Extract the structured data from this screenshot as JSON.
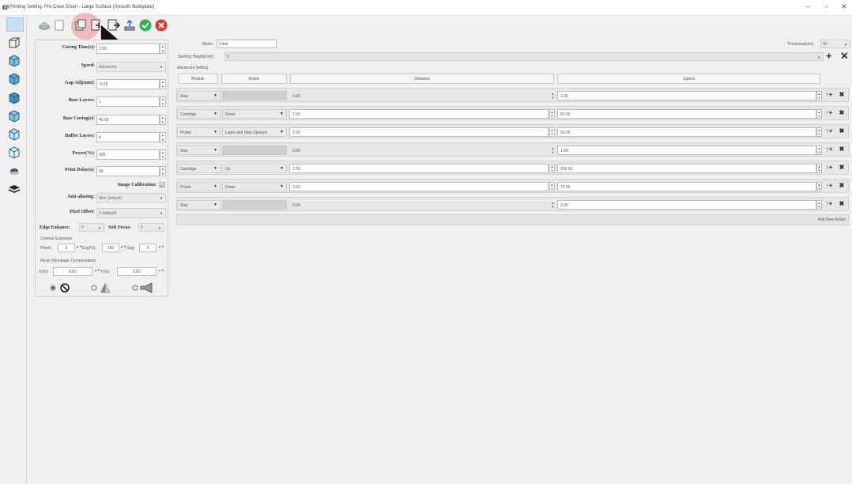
{
  "window": {
    "title": "Printing Setting: Pro Clear 50um - Large Surface (Smooth Buildplate)",
    "controls": [
      "–",
      "▫",
      "✕"
    ]
  },
  "toolbar": {
    "icons": [
      "cloud-icon",
      "new-file-icon",
      "copy-icon",
      "import-icon",
      "export-icon",
      "upload-icon",
      "check-icon",
      "cancel-icon"
    ]
  },
  "sidebar": {
    "icons": [
      "shape-icon",
      "cube-icon-1",
      "cube-icon-2",
      "cube-icon-3",
      "cube-icon-4",
      "cube-icon-5",
      "cube-icon-6",
      "layer-eye-icon",
      "layers-icon"
    ]
  },
  "left_panel": {
    "curing_time": {
      "label": "Curing Time(s):",
      "value": "1.50"
    },
    "speed": {
      "label": "Speed:",
      "value": "Advanced"
    },
    "gap_adj": {
      "label": "Gap Adj(mm):",
      "value": "-0.25"
    },
    "base_layers": {
      "label": "Base Layers:",
      "value": "1"
    },
    "base_curing": {
      "label": "Base Curing(s):",
      "value": "45.00"
    },
    "buffer_layers": {
      "label": "Buffer Layers:",
      "value": "4"
    },
    "power": {
      "label": "Power(%):",
      "value": "100"
    },
    "print_delay": {
      "label": "Print Delay(s):",
      "value": "90"
    },
    "image_calibration": {
      "label": "Image Calibration:",
      "checked": "☑"
    },
    "anti_aliasing": {
      "label": "Anti-aliasing:",
      "value": "Max (default)"
    },
    "pixel_offset": {
      "label": "Pixel Offset:",
      "value": "0 (default)"
    },
    "edge_enhance": {
      "label": "Edge Enhance:",
      "value": "0"
    },
    "soft_focus": {
      "label": "Soft Focus:",
      "value": "0"
    },
    "contour_exposure": {
      "title": "Contour Exposure",
      "pixels_label": "Pixels:",
      "pixels_value": "0",
      "exp_label": "Exp(%):",
      "exp_value": "100",
      "gap_label": "Gap:",
      "gap_value": "0"
    },
    "shrinkage": {
      "title": "Resin Shrinkage Compensation",
      "x_label": "X(%):",
      "x_value": "0.00",
      "y_label": "Y(%):",
      "y_value": "0.00"
    }
  },
  "main": {
    "resin_label": "Resin:",
    "resin_value": "Clear",
    "thickness_label": "Thickness(um):",
    "thickness_value": "50",
    "starting_height_label": "Starting Height(mm):",
    "starting_height_value": "0",
    "advanced_setting_label": "Advanced Setting",
    "headers": {
      "module": "Module",
      "action": "Action",
      "distance": "Distance",
      "speed": "Speed"
    },
    "add_new_action": "Add New Action",
    "rows": [
      {
        "module": "Stay",
        "action": "",
        "distance": "0.00",
        "speed": "1.00"
      },
      {
        "module": "Cartridge",
        "action": "Down",
        "distance": "7.00",
        "speed": "50.00"
      },
      {
        "module": "Picker",
        "action": "Layer and Step Upward",
        "distance": "2.50",
        "speed": "50.00"
      },
      {
        "module": "Stay",
        "action": "",
        "distance": "0.00",
        "speed": "1.00"
      },
      {
        "module": "Cartridge",
        "action": "Up",
        "distance": "7.00",
        "speed": "150.00"
      },
      {
        "module": "Picker",
        "action": "Down",
        "distance": "2.50",
        "speed": "75.00"
      },
      {
        "module": "Stay",
        "action": "",
        "distance": "0.00",
        "speed": "3.00"
      }
    ]
  },
  "colors": {
    "check": "#2fb34a",
    "cancel": "#e03535",
    "cursor_highlight": "#f2a8a8"
  }
}
